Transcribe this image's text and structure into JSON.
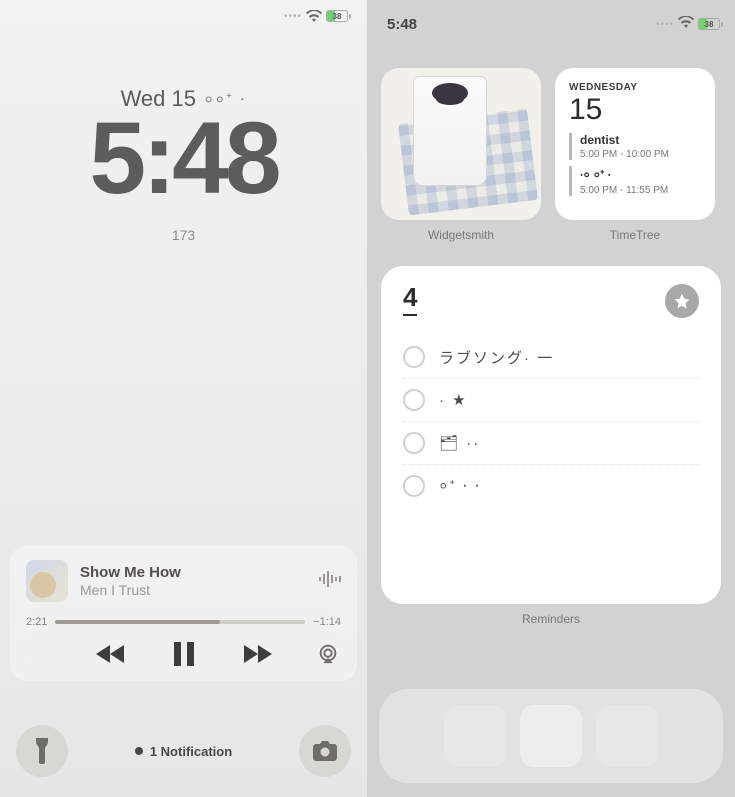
{
  "lock": {
    "status": {
      "battery_pct": "38"
    },
    "date": "Wed 15",
    "date_deco": "⸰⸰⁺ ⸱",
    "time": "5:48",
    "below_clock": "173",
    "music": {
      "title": "Show Me How",
      "artist": "Men I Trust",
      "elapsed": "2:21",
      "remaining": "−1:14"
    },
    "notif_text": "1 Notification"
  },
  "home": {
    "status_time": "5:48",
    "status_battery_pct": "38",
    "widgets": {
      "photo_label": "Widgetsmith",
      "calendar_label": "TimeTree",
      "calendar": {
        "dow": "WEDNESDAY",
        "day": "15",
        "events": [
          {
            "title": "dentist",
            "time": "5:00 PM  - 10:00 PM"
          },
          {
            "title": "⸱⸰ ⸰⁺ ⸱",
            "time": "5:00 PM  - 11:55 PM"
          }
        ]
      },
      "reminders_label": "Reminders",
      "reminders": {
        "count": "4",
        "items": [
          "ラブソング· 一",
          "· ★",
          "🗂 ··",
          "⸰⁺ ⸱ ⸱"
        ]
      }
    }
  }
}
